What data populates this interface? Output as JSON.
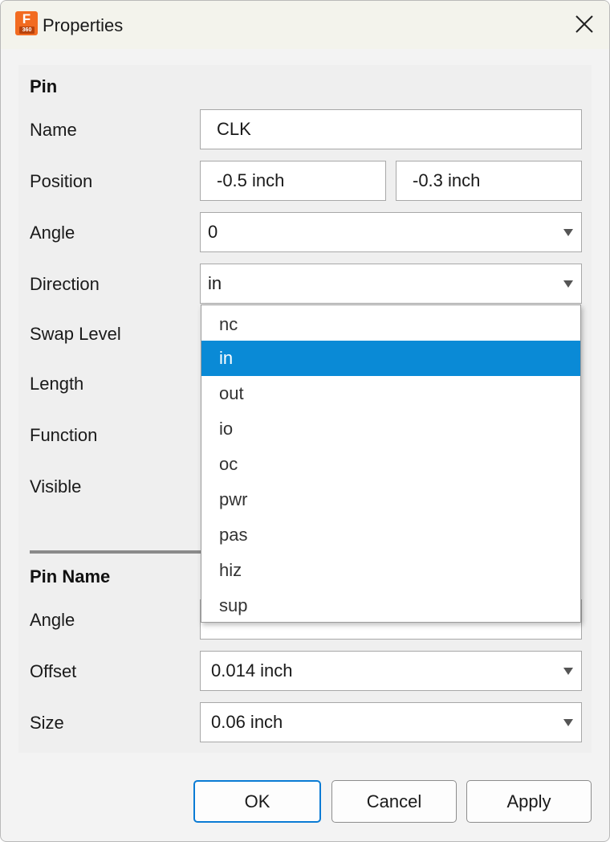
{
  "window": {
    "title": "Properties",
    "app_icon": {
      "letter": "F",
      "sub": "360",
      "color": "#f26b21"
    },
    "close_icon": "close-icon"
  },
  "pin": {
    "section_title": "Pin",
    "name_label": "Name",
    "name_value": "CLK",
    "position_label": "Position",
    "position_x": "-0.5 inch",
    "position_y": "-0.3 inch",
    "angle_label": "Angle",
    "angle_value": "0",
    "direction_label": "Direction",
    "direction_value": "in",
    "swap_level_label": "Swap Level",
    "length_label": "Length",
    "function_label": "Function",
    "visible_label": "Visible"
  },
  "pin_name": {
    "section_title": "Pin Name",
    "angle_label": "Angle",
    "offset_label": "Offset",
    "offset_value": "0.014 inch",
    "size_label": "Size",
    "size_value": "0.06 inch"
  },
  "direction_dropdown": {
    "options": [
      "nc",
      "in",
      "out",
      "io",
      "oc",
      "pwr",
      "pas",
      "hiz",
      "sup"
    ],
    "selected": "in",
    "highlight_color": "#0a8ad6"
  },
  "buttons": {
    "ok": "OK",
    "cancel": "Cancel",
    "apply": "Apply"
  }
}
